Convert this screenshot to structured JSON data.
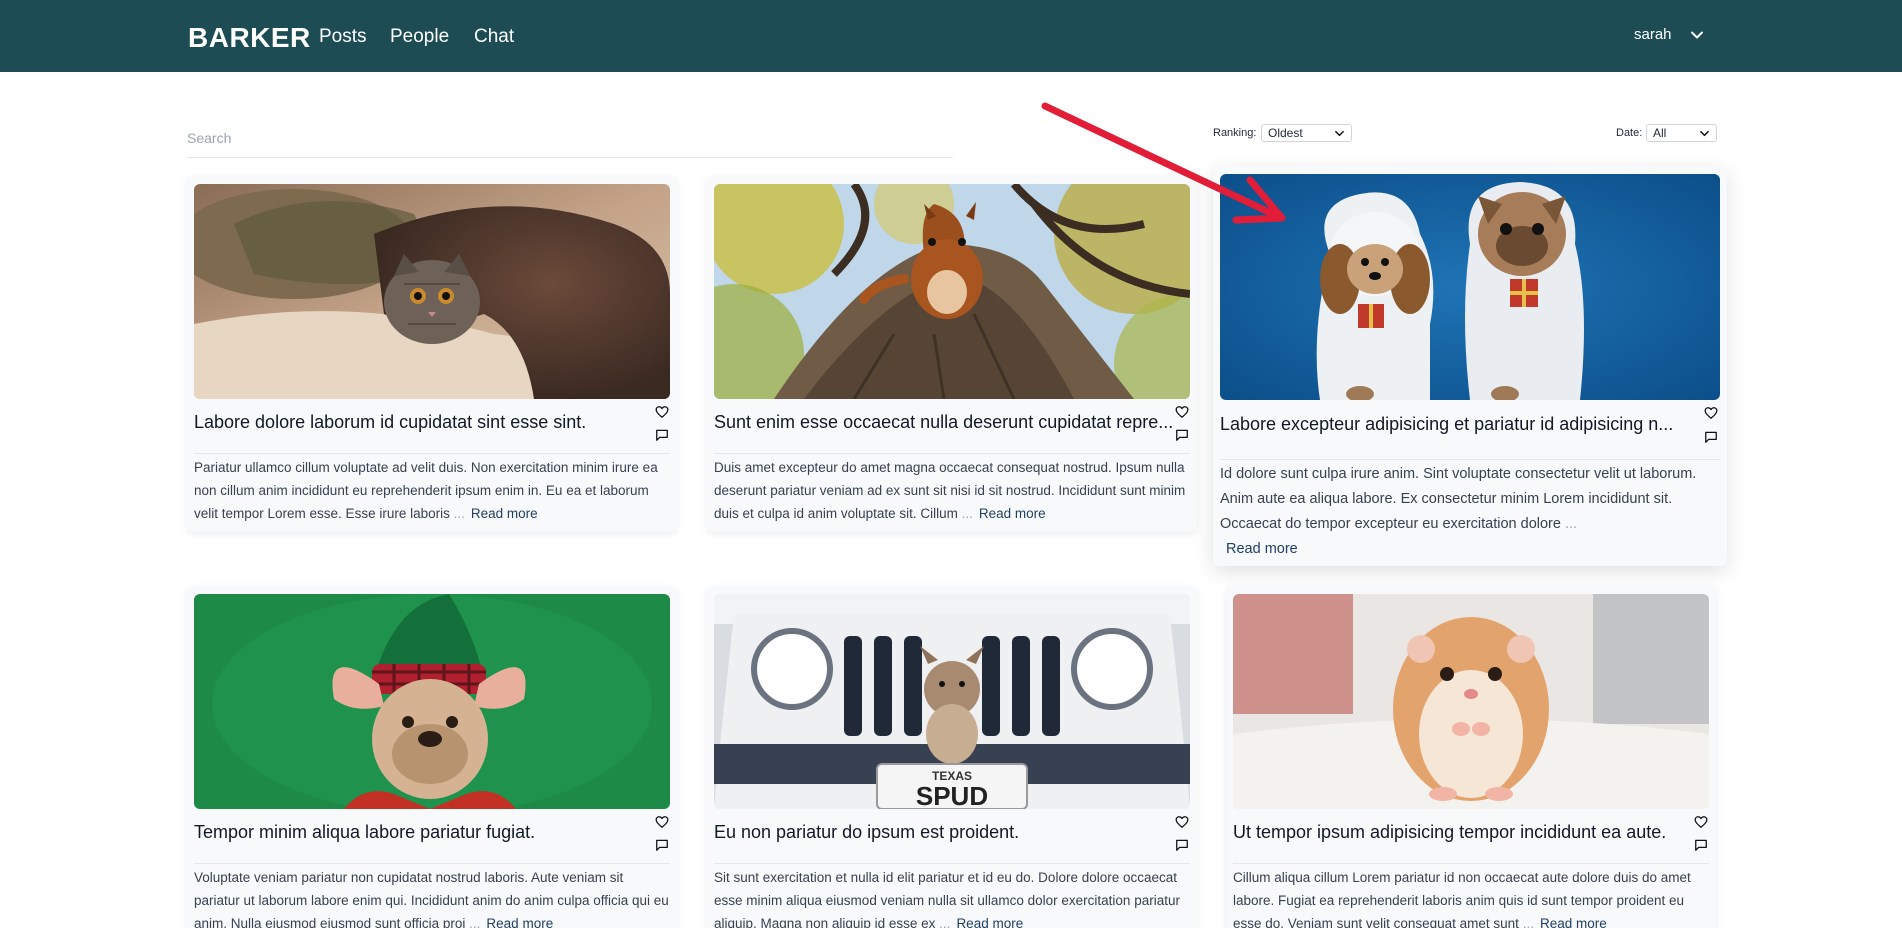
{
  "header": {
    "brand": "BARKER",
    "nav": [
      "Posts",
      "People",
      "Chat"
    ],
    "username": "sarah"
  },
  "controls": {
    "search_placeholder": "Search",
    "ranking_label": "Ranking:",
    "ranking_value": "Oldest",
    "date_label": "Date:",
    "date_value": "All"
  },
  "colors": {
    "header_bg": "#1d4c55",
    "annotation_arrow": "#e11d37"
  },
  "posts": [
    {
      "image": "cat-under-blanket",
      "title": "Labore dolore laborum id cupidatat sint esse sint.",
      "body": "Pariatur ullamco cillum voluptate ad velit duis. Non exercitation minim irure ea non cillum anim incididunt eu reprehenderit ipsum enim in. Eu ea et laborum velit tempor Lorem esse. Esse irure laboris",
      "read_more": "Read more"
    },
    {
      "image": "squirrel-on-tree",
      "title": "Sunt enim esse occaecat nulla deserunt cupidatat repre...",
      "body": "Duis amet excepteur do amet magna occaecat consequat nostrud. Ipsum nulla deserunt pariatur veniam ad ex sunt sit nisi id sit nostrud. Incididunt sunt minim duis et culpa id anim voluptate sit. Cillum",
      "read_more": "Read more"
    },
    {
      "image": "dogs-in-sheep-costumes",
      "title": "Labore excepteur adipisicing et pariatur id adipisicing n...",
      "body": "Id dolore sunt culpa irure anim. Sint voluptate consectetur velit ut laborum. Anim aute ea aliqua labore. Ex consectetur minim Lorem incididunt sit. Occaecat do tempor excepteur eu exercitation dolore",
      "read_more": "Read more"
    },
    {
      "image": "bulldog-elf-hat",
      "title": "Tempor minim aliqua labore pariatur fugiat.",
      "body": "Voluptate veniam pariatur non cupidatat nostrud laboris. Aute veniam sit pariatur ut laborum labore enim qui. Incididunt anim do anim culpa officia qui eu anim. Nulla eiusmod eiusmod sunt officia proi",
      "read_more": "Read more"
    },
    {
      "image": "dog-on-jeep-spud",
      "plate_state": "TEXAS",
      "plate_text": "SPUD",
      "title": "Eu non pariatur do ipsum est proident.",
      "body": "Sit sunt exercitation et nulla id elit pariatur et id eu do. Dolore dolore occaecat esse minim aliqua eiusmod veniam nulla sit ullamco dolor exercitation pariatur aliquip. Magna non aliquip id esse ex",
      "read_more": "Read more"
    },
    {
      "image": "hamster",
      "title": "Ut tempor ipsum adipisicing tempor incididunt ea aute.",
      "body": "Cillum aliqua cillum Lorem pariatur id non occaecat aute dolore duis do amet labore. Fugiat ea reprehenderit laboris anim quis id sunt tempor proident eu esse do. Veniam sunt velit consequat amet sunt",
      "read_more": "Read more"
    }
  ]
}
